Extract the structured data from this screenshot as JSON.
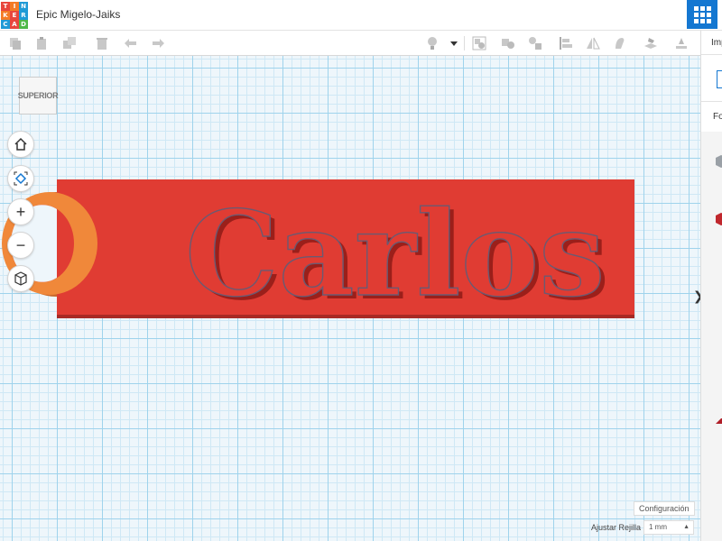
{
  "app": {
    "logo_letters": [
      "T",
      "I",
      "N",
      "K",
      "E",
      "R",
      "C",
      "A",
      "D"
    ],
    "logo_colors": [
      "#e8463d",
      "#f47c26",
      "#1f9ad6",
      "#f47c26",
      "#e8463d",
      "#1f9ad6",
      "#1f9ad6",
      "#e8463d",
      "#4fb848"
    ],
    "title": "Epic Migelo-Jaiks"
  },
  "toolbar": {
    "icons": [
      "copy-icon",
      "paste-icon",
      "duplicate-icon",
      "delete-icon",
      "undo-icon",
      "redo-icon",
      "light-bulb-icon",
      "dropdown-icon",
      "group-icon",
      "ungroup-icon",
      "align-icon",
      "mirror-icon",
      "cruise-icon",
      "workplane-icon",
      "ruler-icon",
      "notes-icon"
    ]
  },
  "workplane": {
    "view_cube_label": "SUPERIOR",
    "object_text": "Carlos",
    "object_color": "#e03c33",
    "ring_color": "#f0883a"
  },
  "settings": {
    "config_label": "Configuración",
    "snap_grid_label": "Ajustar Rejilla",
    "snap_grid_value": "1 mm"
  },
  "right_panel": {
    "import_label": "Importar",
    "forms_label": "Formas básicas",
    "shape_colors": [
      "#9aa0a6",
      "#c0272d",
      "#2f3a8f",
      "#3355cc",
      "#b01e28",
      "#1a73c9",
      "#2e3a7a"
    ]
  }
}
